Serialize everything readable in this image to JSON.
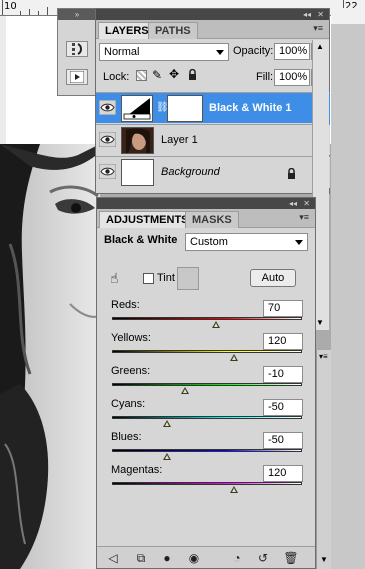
{
  "ruler": {
    "left_number": "10",
    "right_number": "22"
  },
  "layers_panel": {
    "tabs": [
      {
        "label": "LAYERS"
      },
      {
        "label": "PATHS"
      }
    ],
    "blend_mode": "Normal",
    "opacity_label": "Opacity:",
    "opacity_value": "100%",
    "lock_label": "Lock:",
    "fill_label": "Fill:",
    "fill_value": "100%",
    "layers": [
      {
        "name": "Black & White 1",
        "selected": true
      },
      {
        "name": "Layer 1",
        "selected": false
      },
      {
        "name": "Background",
        "selected": false,
        "locked": true
      }
    ]
  },
  "adjustments_panel": {
    "tabs": [
      {
        "label": "ADJUSTMENTS"
      },
      {
        "label": "MASKS"
      }
    ],
    "title": "Black & White",
    "preset": "Custom",
    "tint_label": "Tint",
    "auto_label": "Auto",
    "sliders": [
      {
        "label": "Reds:",
        "value": "70",
        "position": 0.545
      },
      {
        "label": "Yellows:",
        "value": "120",
        "position": 0.64
      },
      {
        "label": "Greens:",
        "value": "-10",
        "position": 0.385
      },
      {
        "label": "Cyans:",
        "value": "-50",
        "position": 0.29
      },
      {
        "label": "Blues:",
        "value": "-50",
        "position": 0.29
      },
      {
        "label": "Magentas:",
        "value": "120",
        "position": 0.64
      }
    ]
  },
  "colors": {
    "selected_row": "#3e8de6",
    "panel_bg": "#d6d6d6",
    "topbar": "#474747"
  }
}
